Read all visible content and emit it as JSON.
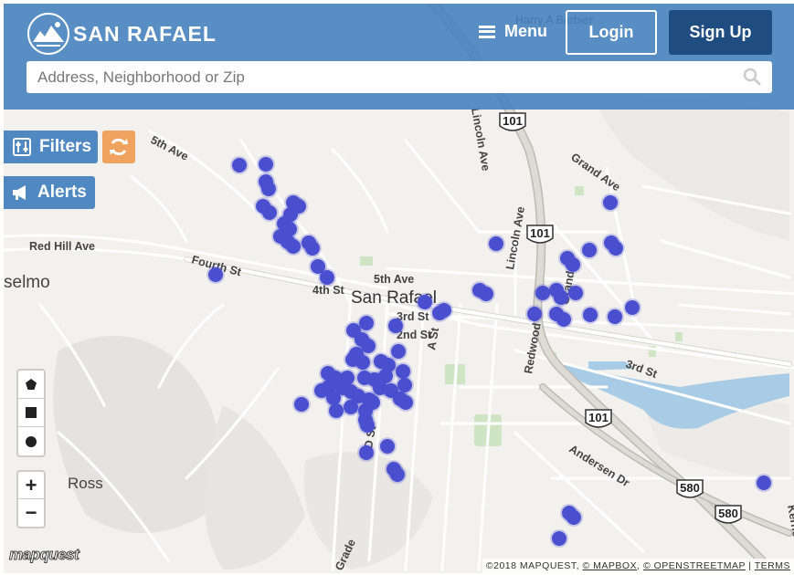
{
  "header": {
    "logo_text": "SAN RAFAEL",
    "menu_label": "Menu",
    "login_label": "Login",
    "signup_label": "Sign Up"
  },
  "search": {
    "placeholder": "Address, Neighborhood or Zip",
    "value": ""
  },
  "controls": {
    "filters_label": "Filters",
    "alerts_label": "Alerts",
    "zoom_in": "+",
    "zoom_out": "−"
  },
  "map": {
    "places": [
      "San Rafael",
      "Anselmo",
      "Ross"
    ],
    "visible_place_text": {
      "selmo": "selmo",
      "ross": "Ross",
      "san_rafael": "San Rafael"
    },
    "streets": [
      "5th Ave",
      "Red Hill Ave",
      "Fourth St",
      "5th Ave",
      "4th St",
      "3rd St",
      "A St",
      "D St",
      "Lincoln Ave",
      "Grand Ave",
      "Andersen Dr",
      "3rd St",
      "Redwood",
      "Grade",
      "Kerne",
      "Harry A Barbier",
      "Grand",
      "101",
      "101",
      "101",
      "580",
      "580"
    ],
    "accent": "#4a4fcf"
  },
  "attribution": {
    "copyright": "©2018 MAPQUEST,",
    "mapbox": "© MAPBOX",
    "osm": "© OPENSTREETMAP",
    "sep": "|",
    "terms": "TERMS",
    "logo": "mapquest"
  }
}
